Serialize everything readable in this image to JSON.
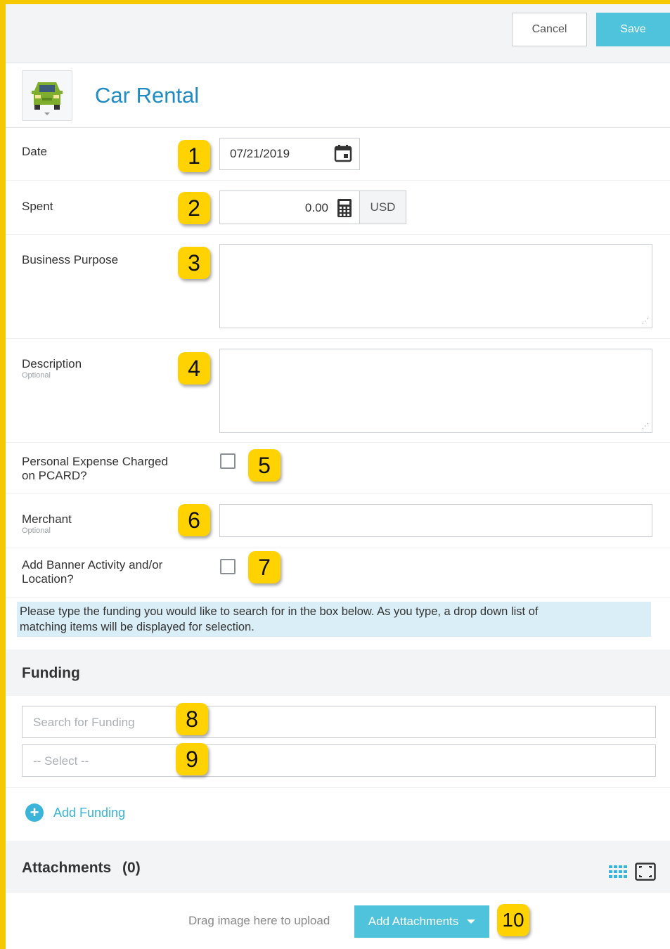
{
  "toolbar": {
    "cancel_label": "Cancel",
    "save_label": "Save"
  },
  "expense": {
    "title": "Car Rental",
    "icon": "car-icon"
  },
  "fields": {
    "date": {
      "label": "Date",
      "value": "07/21/2019"
    },
    "spent": {
      "label": "Spent",
      "value": "0.00",
      "currency": "USD"
    },
    "business_purpose": {
      "label": "Business Purpose",
      "value": ""
    },
    "description": {
      "label": "Description",
      "sublabel": "Optional",
      "value": ""
    },
    "personal_expense": {
      "label_line1": "Personal Expense Charged",
      "label_line2": "on PCARD?",
      "checked": false
    },
    "merchant": {
      "label": "Merchant",
      "sublabel": "Optional",
      "value": ""
    },
    "banner_activity": {
      "label_line1": "Add Banner Activity and/or",
      "label_line2": "Location?",
      "checked": false
    }
  },
  "info": {
    "line1": "Please type the funding you would like to search for in the box below. As you type, a drop down list of",
    "line2": "matching items will be displayed for selection."
  },
  "funding": {
    "title": "Funding",
    "search_placeholder": "Search for Funding",
    "select_placeholder": "-- Select --",
    "add_label": "Add Funding"
  },
  "attachments": {
    "title": "Attachments",
    "count": "(0)",
    "drag_text": "Drag image here to upload",
    "add_label": "Add Attachments"
  },
  "badges": [
    "1",
    "2",
    "3",
    "4",
    "5",
    "6",
    "7",
    "8",
    "9",
    "10"
  ],
  "colors": {
    "accent": "#4fc3dc",
    "title_blue": "#1e8bc3",
    "badge": "#ffd200",
    "frame": "#f5c800",
    "info_bg": "#daeef7"
  }
}
